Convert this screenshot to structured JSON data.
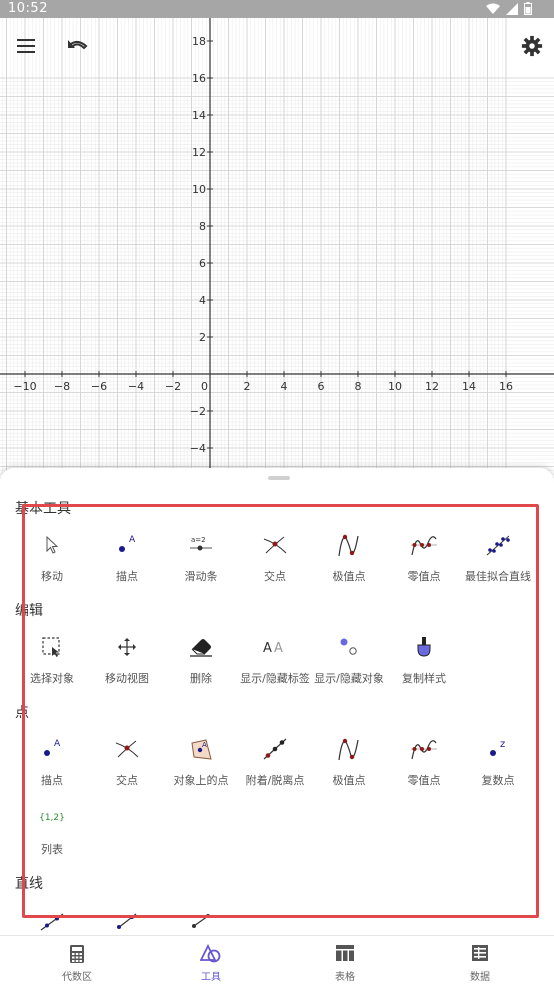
{
  "status_bar": {
    "time": "10:52"
  },
  "graph": {
    "x_ticks": [
      "−10",
      "−8",
      "−6",
      "−4",
      "−2",
      "0",
      "2",
      "4",
      "6",
      "8",
      "10",
      "12",
      "14",
      "16"
    ],
    "y_ticks": [
      "18",
      "16",
      "14",
      "12",
      "10",
      "8",
      "6",
      "4",
      "2",
      "−2",
      "−4"
    ]
  },
  "toolbar": {
    "menu_icon": "menu-icon",
    "undo_icon": "undo-icon",
    "settings_icon": "gear-icon"
  },
  "sections": [
    {
      "title": "基本工具",
      "tools": [
        {
          "label": "移动",
          "icon": "move-icon"
        },
        {
          "label": "描点",
          "icon": "point-icon"
        },
        {
          "label": "滑动条",
          "icon": "slider-icon"
        },
        {
          "label": "交点",
          "icon": "intersect-icon"
        },
        {
          "label": "极值点",
          "icon": "extremum-icon"
        },
        {
          "label": "零值点",
          "icon": "roots-icon"
        },
        {
          "label": "最佳拟合直线",
          "icon": "best-fit-line-icon"
        }
      ]
    },
    {
      "title": "编辑",
      "tools": [
        {
          "label": "选择对象",
          "icon": "select-icon"
        },
        {
          "label": "移动视图",
          "icon": "move-view-icon"
        },
        {
          "label": "删除",
          "icon": "eraser-icon"
        },
        {
          "label": "显示/隐藏标签",
          "icon": "label-icon"
        },
        {
          "label": "显示/隐藏对象",
          "icon": "show-hide-icon"
        },
        {
          "label": "复制样式",
          "icon": "copy-style-icon"
        }
      ]
    },
    {
      "title": "点",
      "tools": [
        {
          "label": "描点",
          "icon": "point-icon"
        },
        {
          "label": "交点",
          "icon": "intersect-icon"
        },
        {
          "label": "对象上的点",
          "icon": "point-on-object-icon"
        },
        {
          "label": "附着/脱离点",
          "icon": "attach-detach-icon"
        },
        {
          "label": "极值点",
          "icon": "extremum-icon"
        },
        {
          "label": "零值点",
          "icon": "roots-icon"
        },
        {
          "label": "复数点",
          "icon": "complex-point-icon"
        },
        {
          "label": "列表",
          "icon": "list-icon",
          "icon_text": "{1,2}"
        }
      ]
    },
    {
      "title": "直线",
      "tools": []
    }
  ],
  "slider_icon_text": "a=2",
  "bottom_nav": [
    {
      "label": "代数区",
      "icon": "calculator-icon"
    },
    {
      "label": "工具",
      "icon": "tools-icon",
      "active": true
    },
    {
      "label": "表格",
      "icon": "table-icon"
    },
    {
      "label": "数据",
      "icon": "data-icon"
    }
  ],
  "colors": {
    "accent": "#6557d2",
    "highlight": "#e0484c",
    "point": "#1a1a8c",
    "curve": "#333333"
  }
}
